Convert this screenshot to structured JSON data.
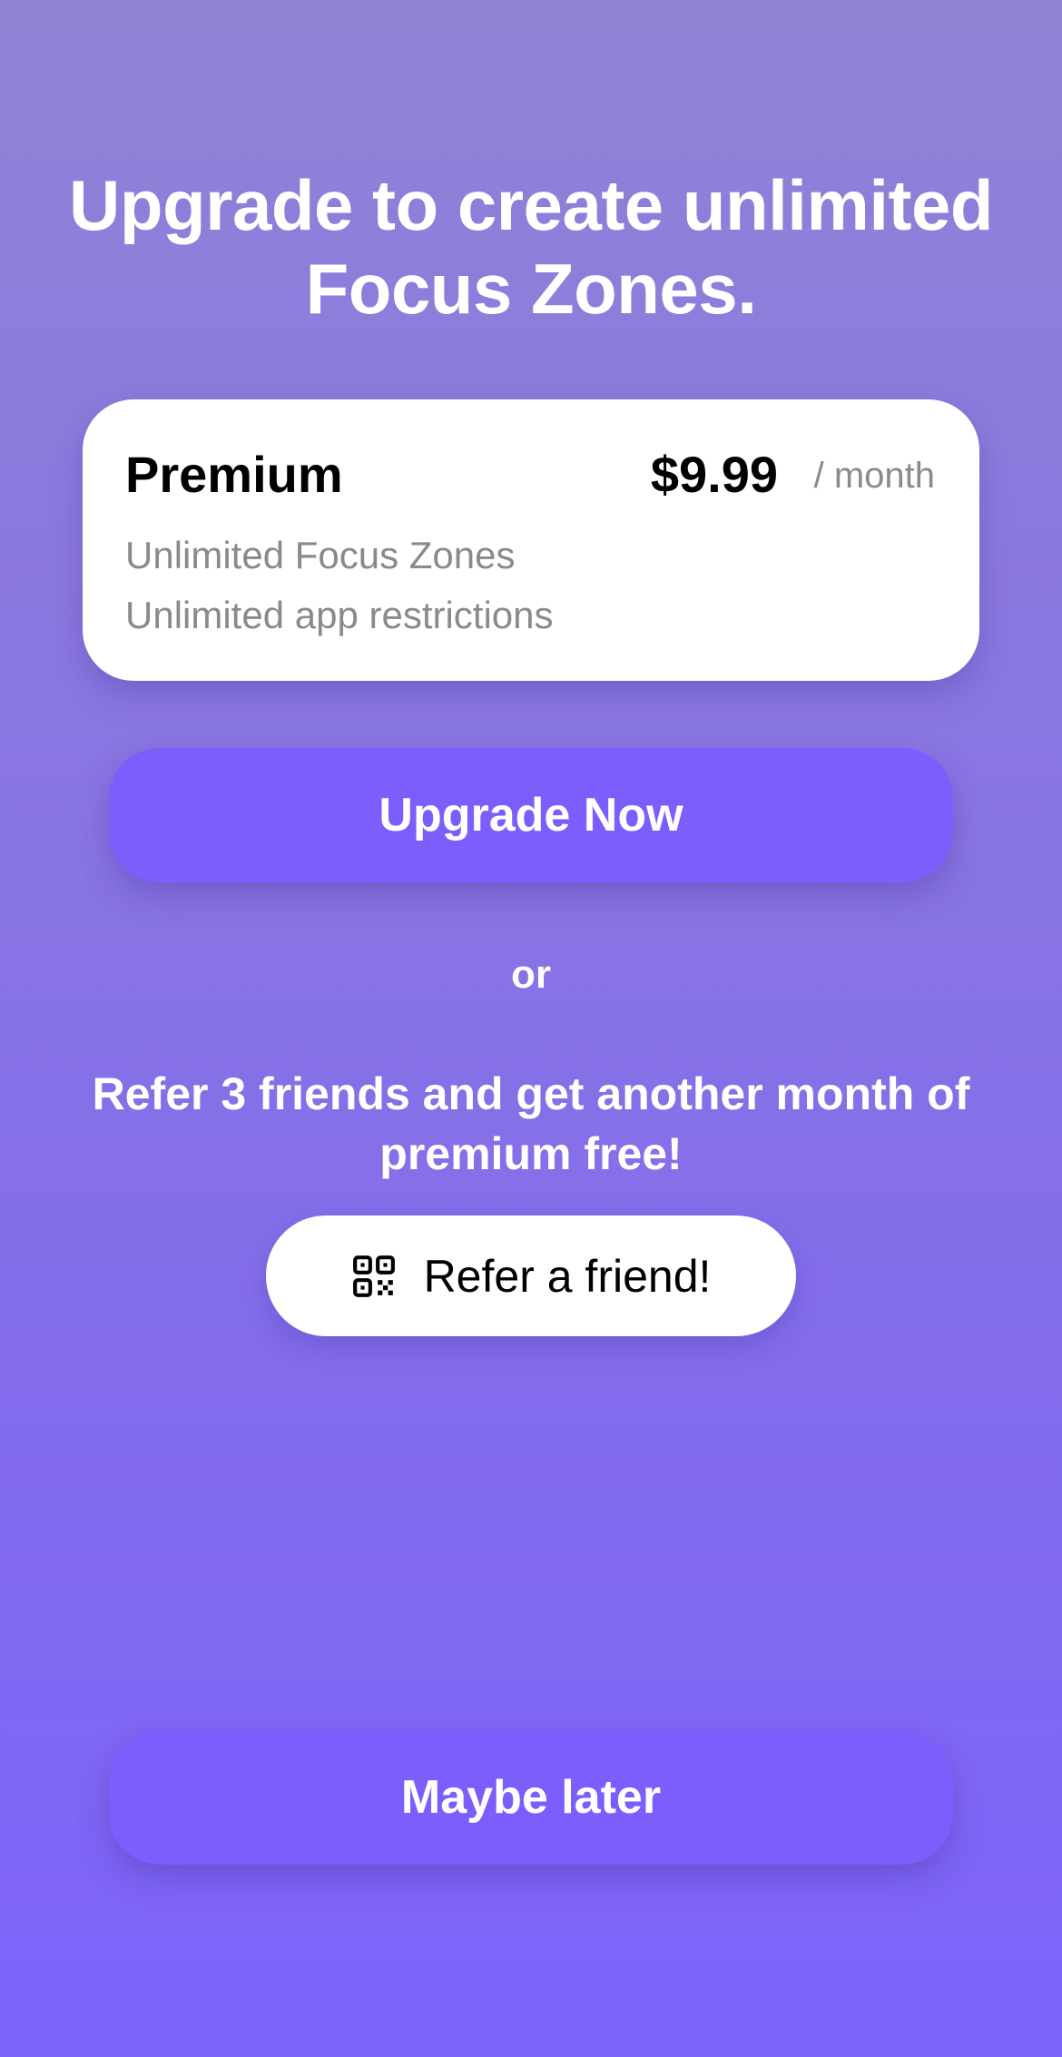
{
  "headline": "Upgrade to create unlimited Focus Zones.",
  "plan": {
    "name": "Premium",
    "price": "$9.99",
    "period": "/ month",
    "features": [
      "Unlimited Focus Zones",
      "Unlimited app restrictions"
    ]
  },
  "upgrade_button": {
    "label": "Upgrade Now"
  },
  "divider_text": "or",
  "referral": {
    "message": "Refer 3 friends and get another month of premium free!",
    "button_label": "Refer a friend!",
    "button_icon": "qr-code-icon"
  },
  "dismiss_button": {
    "label": "Maybe later"
  },
  "colors": {
    "background_top": "#9182d6",
    "background_bottom": "#7d62fa",
    "primary_button": "#7b5efc",
    "card": "#ffffff",
    "secondary_text": "#8a8a8e"
  }
}
